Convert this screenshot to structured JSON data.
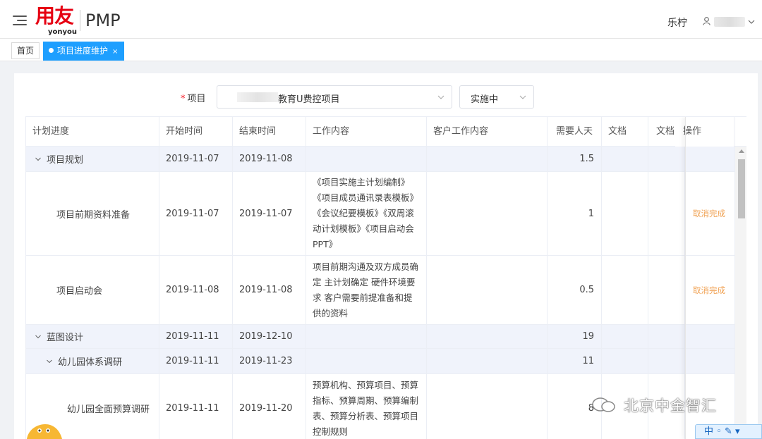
{
  "header": {
    "logo_main": "用友",
    "logo_sub": "yonyou",
    "app_name": "PMP",
    "user_label": "乐柠"
  },
  "tabs": {
    "home": "首页",
    "active": "项目进度维护",
    "close": "×"
  },
  "filters": {
    "required_mark": "*",
    "project_label": "项目",
    "project_value": "教育U费控项目",
    "status_value": "实施中"
  },
  "table": {
    "headers": [
      "计划进度",
      "开始时间",
      "结束时间",
      "工作内容",
      "客户工作内容",
      "需要人天",
      "文档",
      "文档",
      "操作"
    ],
    "rows": [
      {
        "name": "项目规划",
        "start": "2019-11-07",
        "end": "2019-11-08",
        "content": "",
        "days": "1.5",
        "action": ""
      },
      {
        "name": "项目前期资料准备",
        "start": "2019-11-07",
        "end": "2019-11-07",
        "content": "《项目实施主计划编制》《项目成员通讯录表模板》《会议纪要模板》《双周滚动计划模板》《项目启动会PPT》",
        "days": "1",
        "action": "取消完成"
      },
      {
        "name": "项目启动会",
        "start": "2019-11-08",
        "end": "2019-11-08",
        "content": "项目前期沟通及双方成员确定 主计划确定 硬件环境要求 客户需要前提准备和提供的资料",
        "days": "0.5",
        "action": "取消完成"
      },
      {
        "name": "蓝图设计",
        "start": "2019-11-11",
        "end": "2019-12-10",
        "content": "",
        "days": "19",
        "action": ""
      },
      {
        "name": "幼儿园体系调研",
        "start": "2019-11-11",
        "end": "2019-11-23",
        "content": "",
        "days": "11",
        "action": ""
      },
      {
        "name": "幼儿园全面预算调研",
        "start": "2019-11-11",
        "end": "2019-11-20",
        "content": "预算机构、预算项目、预算指标、预算周期、预算编制表、预算分析表、预算项目控制规则",
        "days": "8",
        "action": ""
      }
    ]
  },
  "watermark": "北京中金智汇",
  "ime": "中"
}
